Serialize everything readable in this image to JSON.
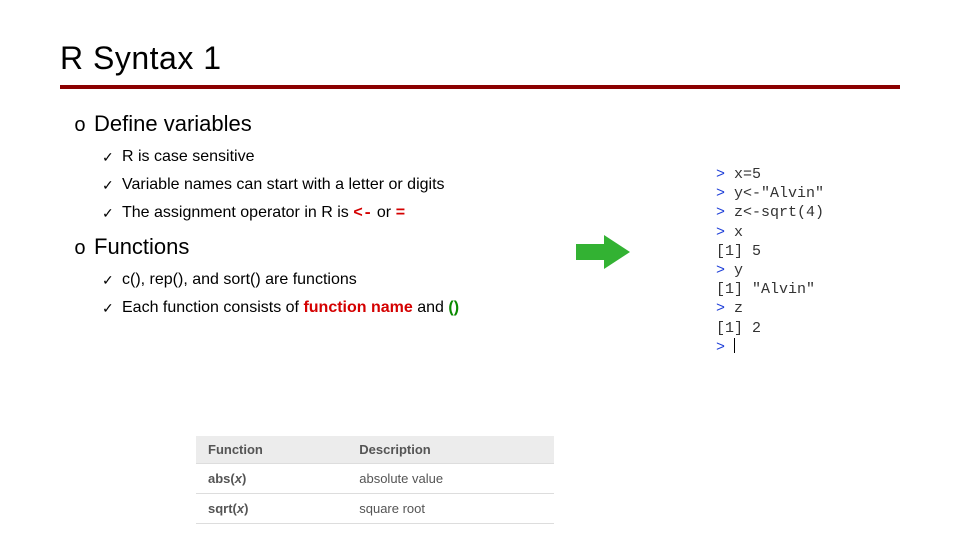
{
  "title": "R Syntax 1",
  "sections": {
    "define": {
      "heading": "Define variables",
      "bullets": {
        "b0": "R is case sensitive",
        "b1": "Variable names can start with a letter or digits",
        "b2_pre": "The assignment operator in R is",
        "b2_op1": "<-",
        "b2_mid": "or",
        "b2_op2": "="
      }
    },
    "functions": {
      "heading": "Functions",
      "bullets": {
        "b0": "c(), rep(), and sort() are functions",
        "b1_pre": "Each function consists of",
        "b1_name": "function name",
        "b1_mid": "and",
        "b1_paren": "()"
      }
    }
  },
  "table": {
    "head_fn": "Function",
    "head_desc": "Description",
    "r0_fn_name": "abs(",
    "r0_fn_arg": "x",
    "r0_fn_close": ")",
    "r0_desc": "absolute value",
    "r1_fn_name": "sqrt(",
    "r1_fn_arg": "x",
    "r1_fn_close": ")",
    "r1_desc": "square root"
  },
  "console": {
    "l0_p": "> ",
    "l0": "x=5",
    "l1_p": "> ",
    "l1": "y<-\"Alvin\"",
    "l2_p": "> ",
    "l2": "z<-sqrt(4)",
    "l3_p": "> ",
    "l3": "x",
    "l4": "[1] 5",
    "l5_p": "> ",
    "l5": "y",
    "l6": "[1] \"Alvin\"",
    "l7_p": "> ",
    "l7": "z",
    "l8": "[1] 2",
    "l9_p": "> "
  }
}
